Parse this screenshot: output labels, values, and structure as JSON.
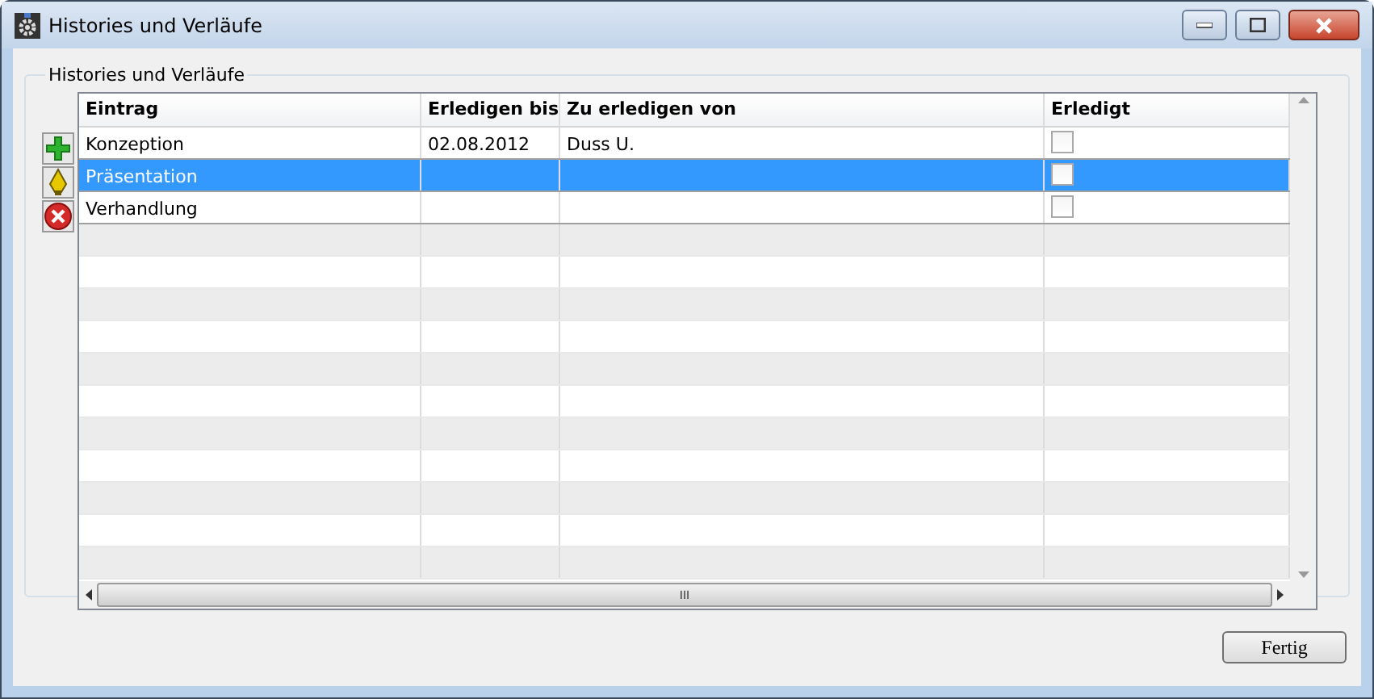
{
  "window": {
    "title": "Histories und Verläufe"
  },
  "group": {
    "title": "Histories und Verläufe"
  },
  "table": {
    "columns": [
      "Eintrag",
      "Erledigen bis",
      "Zu erledigen von",
      "Erledigt"
    ],
    "rows": [
      {
        "entry": "Konzeption",
        "due": "02.08.2012",
        "assignee": "Duss U.",
        "done": false,
        "selected": false
      },
      {
        "entry": "Präsentation",
        "due": "",
        "assignee": "",
        "done": false,
        "selected": true
      },
      {
        "entry": "Verhandlung",
        "due": "",
        "assignee": "",
        "done": false,
        "selected": false
      }
    ]
  },
  "scrollbar_grip": "III",
  "buttons": [
    "Fertig"
  ]
}
